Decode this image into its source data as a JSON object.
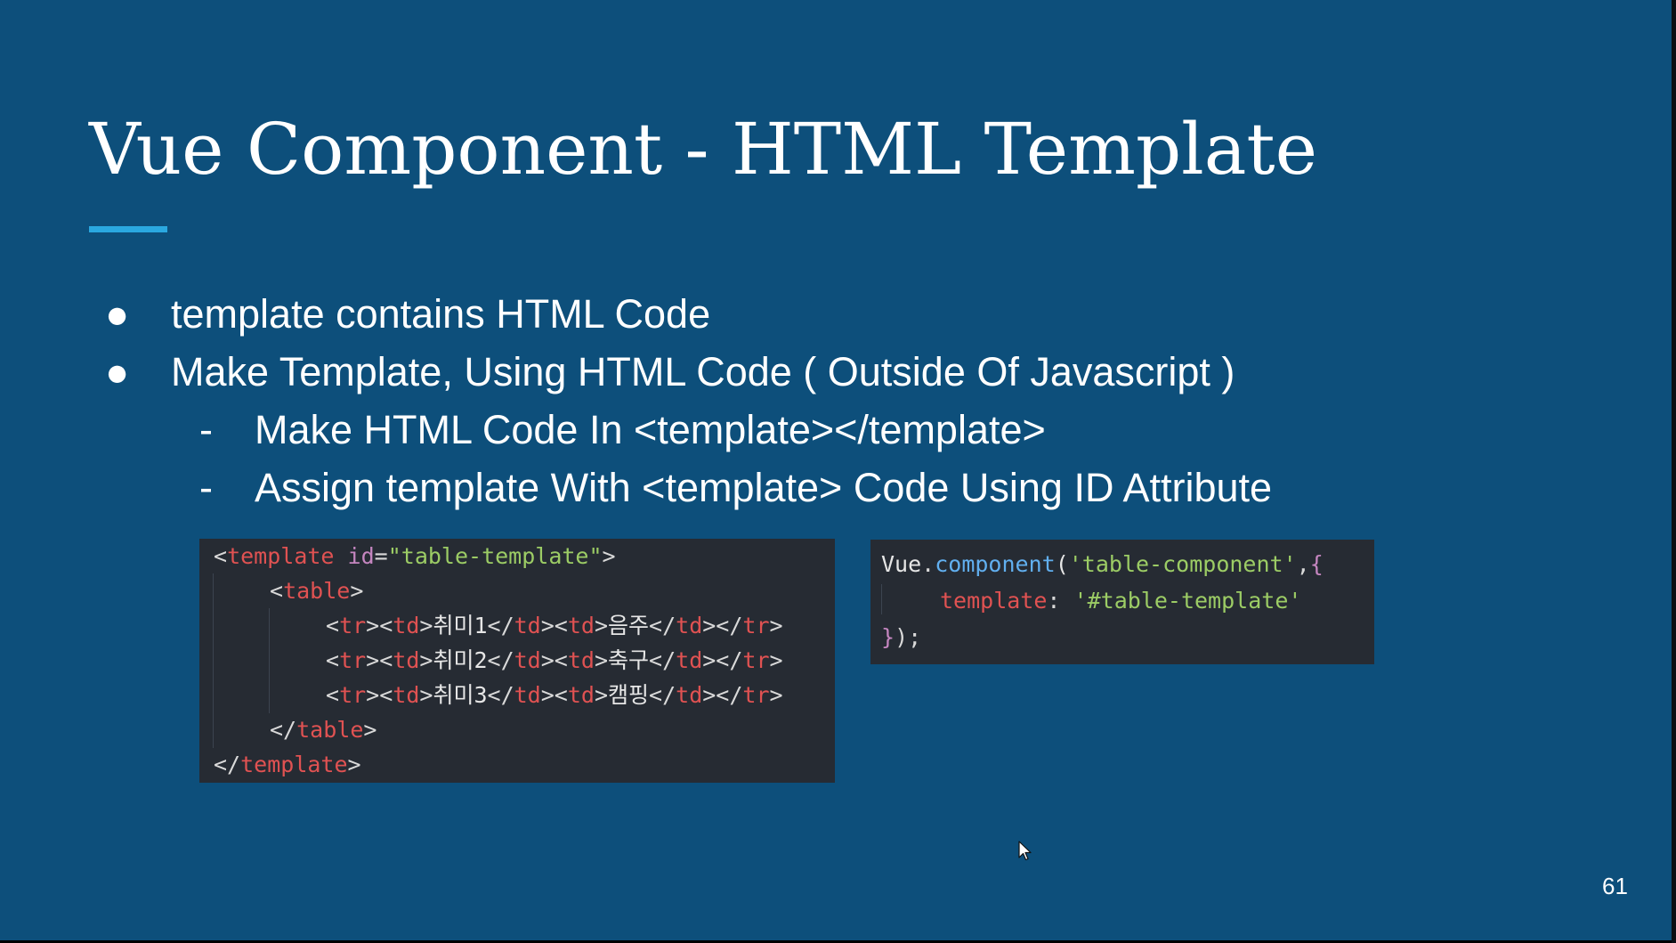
{
  "slide": {
    "title": "Vue Component - HTML Template",
    "page_number": "61",
    "colors": {
      "background": "#0d4f7b",
      "title_rule": "#2aa8e0",
      "code_background": "#262b33"
    }
  },
  "bullets": [
    {
      "marker": "●",
      "text": "template contains HTML Code"
    },
    {
      "marker": "●",
      "text": "Make Template, Using HTML Code ( Outside Of Javascript )"
    },
    {
      "marker": "-",
      "text": "Make HTML Code In <template></template>"
    },
    {
      "marker": "-",
      "text": "Assign template With <template> Code Using ID Attribute"
    }
  ],
  "code_left": {
    "l1": {
      "open": "<",
      "tag": "template",
      "attr": "id",
      "eq": "=",
      "val": "\"table-template\"",
      "close": ">"
    },
    "l2": {
      "open": "<",
      "tag": "table",
      "close": ">"
    },
    "rows": [
      {
        "hobby": "취미1",
        "value": "음주"
      },
      {
        "hobby": "취미2",
        "value": "축구"
      },
      {
        "hobby": "취미3",
        "value": "캠핑"
      }
    ],
    "row_tags": {
      "tr": "tr",
      "td": "td"
    },
    "l6": {
      "open": "</",
      "tag": "table",
      "close": ">"
    },
    "l7": {
      "open": "</",
      "tag": "template",
      "close": ">"
    }
  },
  "code_right": {
    "obj": "Vue",
    "dot": ".",
    "fn": "component",
    "paren_open": "(",
    "arg": "'table-component'",
    "sep": ",",
    "brace_open": "{",
    "key": "template",
    "colon": ":",
    "key_val": "'#table-template'",
    "brace_close": "}",
    "end": ");"
  },
  "icons": {
    "cursor": "mouse-pointer-icon"
  }
}
